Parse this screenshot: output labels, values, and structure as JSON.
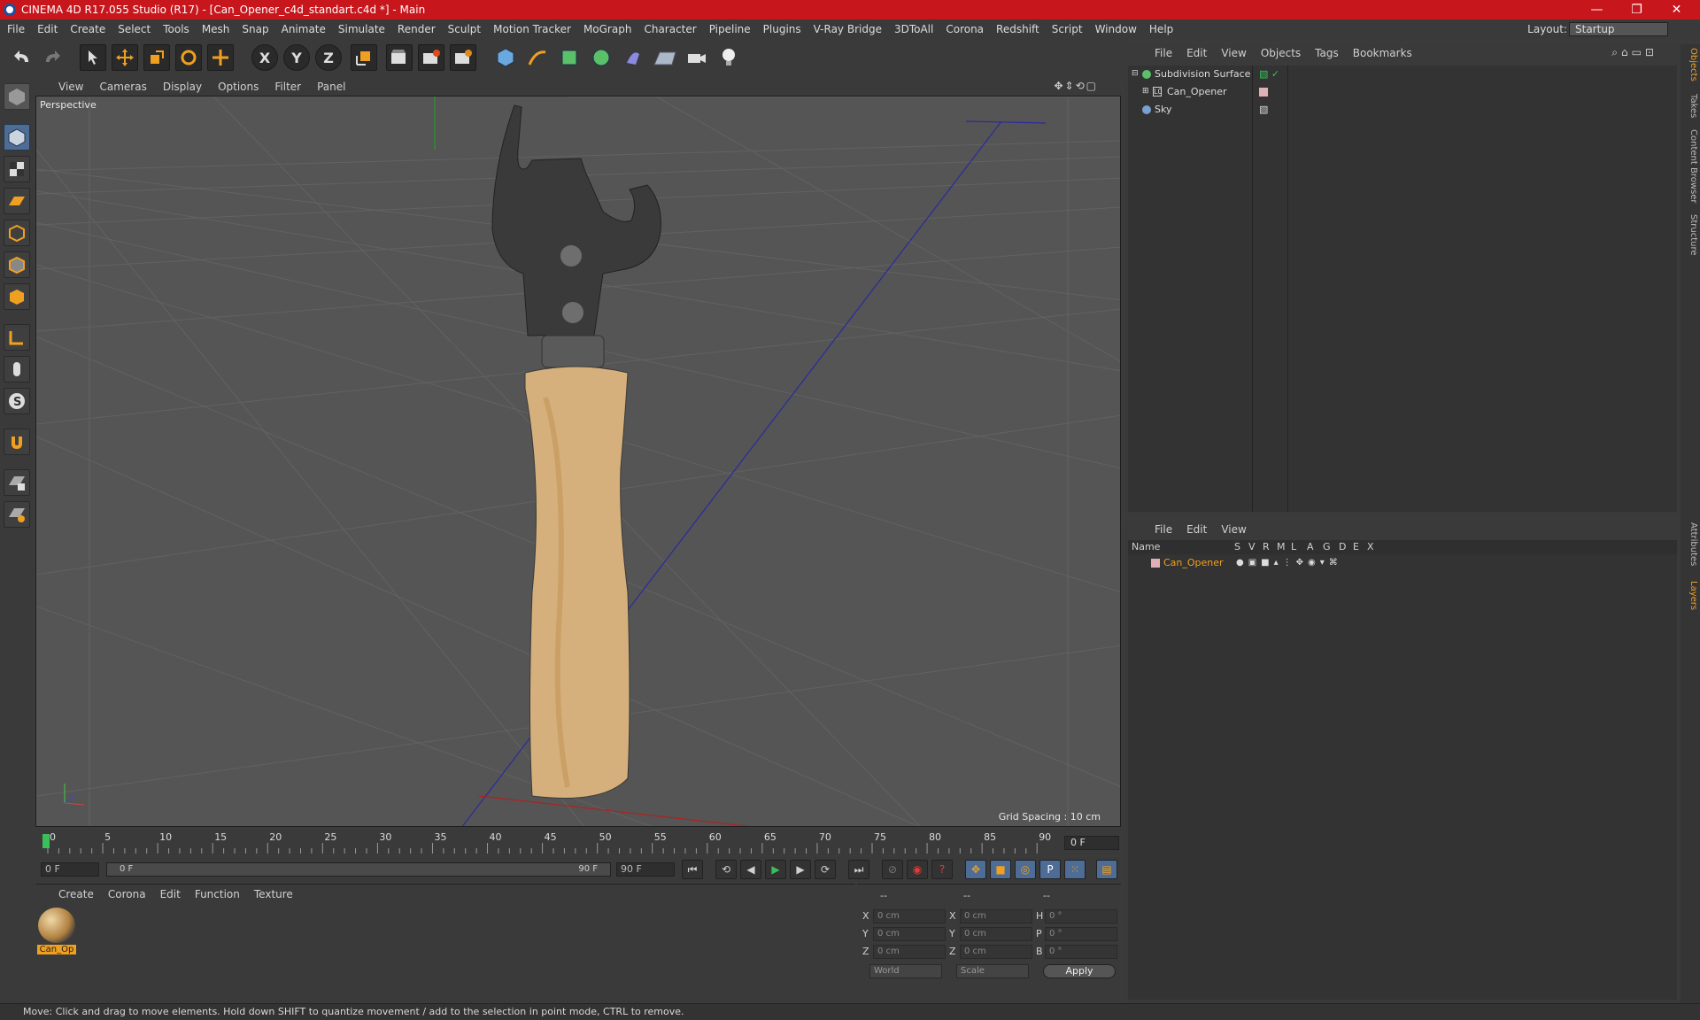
{
  "titlebar": {
    "title": "CINEMA 4D R17.055 Studio (R17) - [Can_Opener_c4d_standart.c4d *] - Main",
    "minimize": "—",
    "restore": "❐",
    "close": "✕"
  },
  "menubar": {
    "items": [
      "File",
      "Edit",
      "Create",
      "Select",
      "Tools",
      "Mesh",
      "Snap",
      "Animate",
      "Simulate",
      "Render",
      "Sculpt",
      "Motion Tracker",
      "MoGraph",
      "Character",
      "Pipeline",
      "Plugins",
      "V-Ray Bridge",
      "3DToAll",
      "Corona",
      "Redshift",
      "Script",
      "Window",
      "Help"
    ],
    "layout_label": "Layout:",
    "layout_value": "Startup"
  },
  "toolbar": {
    "axis_x": "X",
    "axis_y": "Y",
    "axis_z": "Z"
  },
  "viewport": {
    "menu": [
      "View",
      "Cameras",
      "Display",
      "Options",
      "Filter",
      "Panel"
    ],
    "label": "Perspective",
    "grid_spacing": "Grid Spacing : 10 cm"
  },
  "timeline": {
    "ticks": [
      "0",
      "5",
      "10",
      "15",
      "20",
      "25",
      "30",
      "35",
      "40",
      "45",
      "50",
      "55",
      "60",
      "65",
      "70",
      "75",
      "80",
      "85",
      "90"
    ],
    "current_frame": "0 F"
  },
  "transport": {
    "start": "0 F",
    "slider_start": "0 F",
    "slider_end": "90 F",
    "end": "90 F"
  },
  "materials": {
    "menu": [
      "Create",
      "Corona",
      "Edit",
      "Function",
      "Texture"
    ],
    "items": [
      {
        "name": "Can_Op"
      }
    ]
  },
  "coords": {
    "hdr1": "--",
    "hdr2": "--",
    "hdr3": "--",
    "rows": [
      {
        "a": "X",
        "va": "0 cm",
        "b": "X",
        "vb": "0 cm",
        "c": "H",
        "vc": "0 °"
      },
      {
        "a": "Y",
        "va": "0 cm",
        "b": "Y",
        "vb": "0 cm",
        "c": "P",
        "vc": "0 °"
      },
      {
        "a": "Z",
        "va": "0 cm",
        "b": "Z",
        "vb": "0 cm",
        "c": "B",
        "vc": "0 °"
      }
    ],
    "world": "World",
    "scale": "Scale",
    "apply": "Apply"
  },
  "status": "Move: Click and drag to move elements. Hold down SHIFT to quantize movement / add to the selection in point mode, CTRL to remove.",
  "objects": {
    "menu": [
      "File",
      "Edit",
      "View",
      "Objects",
      "Tags",
      "Bookmarks"
    ],
    "rows": [
      {
        "name": "Subdivision Surface"
      },
      {
        "name": "Can_Opener"
      },
      {
        "name": "Sky"
      }
    ]
  },
  "layers": {
    "menu": [
      "File",
      "Edit",
      "View"
    ],
    "header": {
      "name": "Name",
      "cols": [
        "S",
        "V",
        "R",
        "M",
        "L",
        "A",
        "G",
        "D",
        "E",
        "X"
      ]
    },
    "rows": [
      {
        "name": "Can_Opener"
      }
    ]
  },
  "side_tabs": [
    "Objects",
    "Takes",
    "Content Browser",
    "Structure",
    "Attributes",
    "Layers"
  ],
  "colors": {
    "title": "#c8161d",
    "accent": "#f0a020",
    "selected_tab": "#4d6c96"
  }
}
